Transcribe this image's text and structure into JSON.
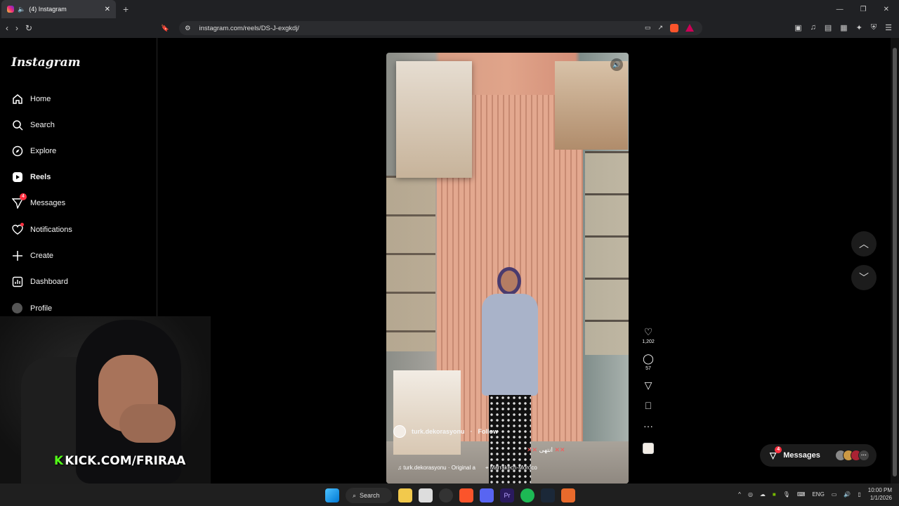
{
  "browser": {
    "tab_title": "(4) Instagram",
    "url": "instagram.com/reels/DS-J-exgkdj/"
  },
  "sidebar": {
    "logo": "Instagram",
    "items": [
      {
        "label": "Home",
        "icon": "home-icon"
      },
      {
        "label": "Search",
        "icon": "search-icon"
      },
      {
        "label": "Explore",
        "icon": "compass-icon"
      },
      {
        "label": "Reels",
        "icon": "reels-icon",
        "active": true
      },
      {
        "label": "Messages",
        "icon": "send-icon",
        "badge": "4"
      },
      {
        "label": "Notifications",
        "icon": "heart-icon",
        "dot": true
      },
      {
        "label": "Create",
        "icon": "plus-icon"
      },
      {
        "label": "Dashboard",
        "icon": "chart-icon"
      },
      {
        "label": "Profile",
        "icon": "avatar-icon"
      }
    ]
  },
  "reel": {
    "username": "turk.dekorasyonu",
    "follow": "Follow",
    "caption_arabic": "انتهى",
    "audio": "turk.dekorasyonu · Original a",
    "location": "Marrakech-Moroco",
    "likes": "1,202",
    "comments": "57"
  },
  "messages_pill": {
    "label": "Messages",
    "badge": "4",
    "more": "···"
  },
  "overlay": {
    "kick_text": "KICK.COM/FRIRAA",
    "kick_k": "K"
  },
  "taskbar": {
    "search": "Search",
    "lang": "ENG",
    "time": "10:00 PM",
    "date": "1/1/2026"
  },
  "colors": {
    "accent_badge": "#ff3040",
    "kick_green": "#53fc18"
  }
}
